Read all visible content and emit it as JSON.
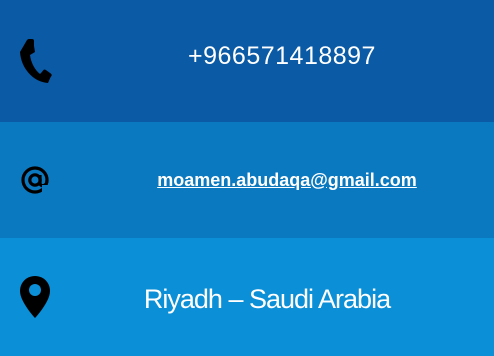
{
  "contact": {
    "phone": {
      "icon": "phone-icon",
      "value": "+966571418897"
    },
    "email": {
      "icon": "at-icon",
      "value": "moamen.abudaqa@gmail.com"
    },
    "location": {
      "icon": "map-pin-icon",
      "value": "Riyadh – Saudi Arabia"
    }
  },
  "colors": {
    "phone_row": "#0a5aa5",
    "email_row": "#0b79c0",
    "location_row": "#0b8fd6",
    "icon": "#000000",
    "text": "#ffffff"
  }
}
